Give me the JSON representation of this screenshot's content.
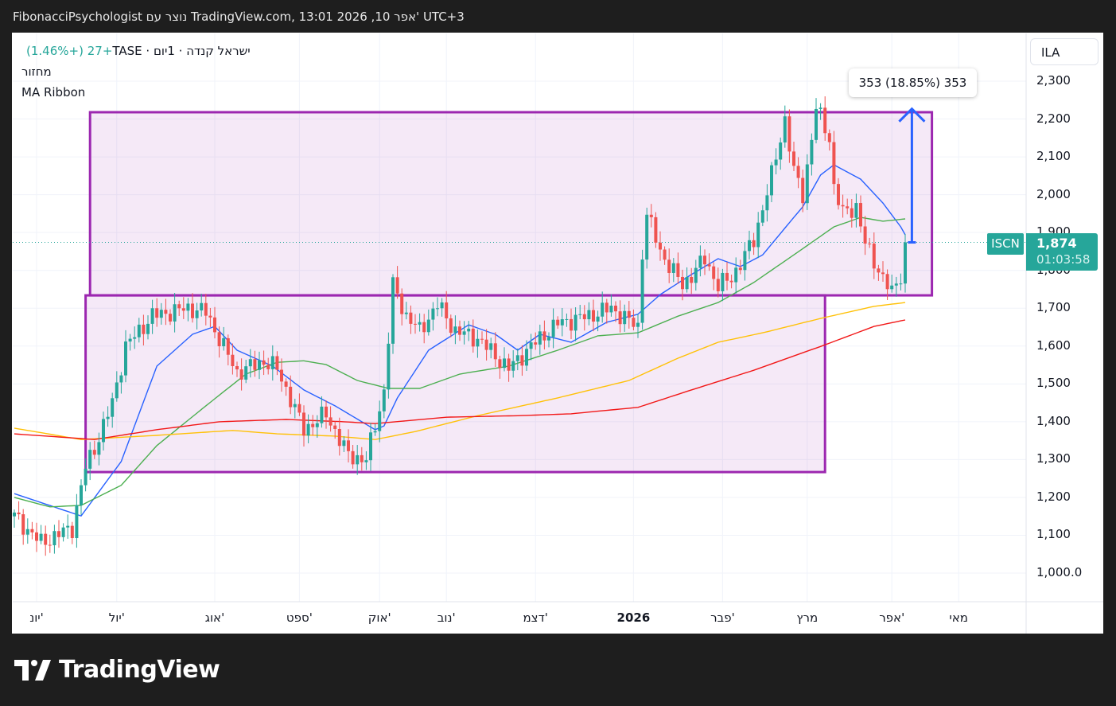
{
  "header": {
    "title": "FibonacciPsychologist נוצר עם TradingView.com, 13:01 2026 ,10 אפר' UTC+3"
  },
  "legend": {
    "symbol_line": "ישראל קנדה · 1יום · TASE",
    "change": "+27 (+1.46%)",
    "volume": "מחזור",
    "indicator": "MA Ribbon"
  },
  "price_axis": {
    "currency": "ILA",
    "ticks": [
      "2,300",
      "2,200",
      "2,100",
      "2,000",
      "1,900",
      "1,800",
      "1,700",
      "1,600",
      "1,500",
      "1,400",
      "1,300",
      "1,200",
      "1,100",
      "1,000.0"
    ]
  },
  "last_price": {
    "symbol": "ISCN",
    "price": "1,874",
    "countdown": "01:03:58"
  },
  "measure": {
    "label": "353 (18.85%) 353"
  },
  "footer": {
    "brand": "TradingView"
  },
  "colors": {
    "up": "#26a69a",
    "down": "#ef5350",
    "ma20": "#2962ff",
    "ma50": "#4caf50",
    "ma100": "#ffc107",
    "ma200": "#f21818",
    "box": "#9c27b0",
    "arrow": "#2962ff"
  },
  "chart_data": {
    "type": "candlestick",
    "yrange": [
      1000,
      2300
    ],
    "xrange_days": [
      0,
      200
    ],
    "time_ticks": [
      {
        "label": "יונ'",
        "day": 5
      },
      {
        "label": "יול'",
        "day": 23
      },
      {
        "label": "אוג'",
        "day": 45
      },
      {
        "label": "ספט'",
        "day": 64
      },
      {
        "label": "אוק'",
        "day": 82
      },
      {
        "label": "נוב'",
        "day": 97
      },
      {
        "label": "דצמ'",
        "day": 117
      },
      {
        "label": "2026",
        "day": 139,
        "bold": true
      },
      {
        "label": "פבר'",
        "day": 159
      },
      {
        "label": "מרץ",
        "day": 178
      },
      {
        "label": "אפר'",
        "day": 197
      },
      {
        "label": "מאי",
        "day": 212
      }
    ],
    "price_ticks": [
      2300,
      2200,
      2100,
      2000,
      1900,
      1800,
      1700,
      1600,
      1500,
      1400,
      1300,
      1200,
      1100,
      1000
    ],
    "close_keypoints": [
      [
        0,
        1150
      ],
      [
        6,
        1080
      ],
      [
        13,
        1120
      ],
      [
        16,
        1280
      ],
      [
        18,
        1330
      ],
      [
        22,
        1450
      ],
      [
        25,
        1600
      ],
      [
        31,
        1680
      ],
      [
        39,
        1700
      ],
      [
        43,
        1690
      ],
      [
        46,
        1620
      ],
      [
        50,
        1530
      ],
      [
        56,
        1560
      ],
      [
        59,
        1540
      ],
      [
        65,
        1380
      ],
      [
        70,
        1420
      ],
      [
        75,
        1310
      ],
      [
        79,
        1300
      ],
      [
        83,
        1480
      ],
      [
        85,
        1760
      ],
      [
        88,
        1680
      ],
      [
        91,
        1640
      ],
      [
        95,
        1710
      ],
      [
        99,
        1640
      ],
      [
        104,
        1620
      ],
      [
        111,
        1540
      ],
      [
        116,
        1600
      ],
      [
        122,
        1660
      ],
      [
        129,
        1680
      ],
      [
        134,
        1700
      ],
      [
        140,
        1650
      ],
      [
        141,
        1850
      ],
      [
        142,
        1950
      ],
      [
        145,
        1850
      ],
      [
        150,
        1760
      ],
      [
        155,
        1830
      ],
      [
        158,
        1760
      ],
      [
        161,
        1780
      ],
      [
        166,
        1880
      ],
      [
        170,
        2050
      ],
      [
        173,
        2200
      ],
      [
        175,
        2060
      ],
      [
        177,
        2000
      ],
      [
        179,
        2150
      ],
      [
        180,
        2230
      ],
      [
        183,
        2150
      ],
      [
        184,
        2020
      ],
      [
        186,
        1950
      ],
      [
        189,
        1970
      ],
      [
        191,
        1870
      ],
      [
        195,
        1780
      ],
      [
        197,
        1740
      ],
      [
        199,
        1790
      ],
      [
        200,
        1874
      ]
    ],
    "ma_series": [
      {
        "name": "MA20",
        "color_key": "ma20",
        "points": [
          [
            0,
            1210
          ],
          [
            15,
            1151
          ],
          [
            24,
            1295
          ],
          [
            32,
            1547
          ],
          [
            40,
            1631
          ],
          [
            45,
            1652
          ],
          [
            50,
            1589
          ],
          [
            58,
            1547
          ],
          [
            65,
            1484
          ],
          [
            72,
            1442
          ],
          [
            81,
            1379
          ],
          [
            83,
            1389
          ],
          [
            86,
            1463
          ],
          [
            93,
            1589
          ],
          [
            102,
            1656
          ],
          [
            108,
            1631
          ],
          [
            113,
            1589
          ],
          [
            118,
            1631
          ],
          [
            125,
            1610
          ],
          [
            133,
            1663
          ],
          [
            140,
            1684
          ],
          [
            145,
            1736
          ],
          [
            152,
            1789
          ],
          [
            158,
            1831
          ],
          [
            163,
            1810
          ],
          [
            168,
            1841
          ],
          [
            174,
            1926
          ],
          [
            177,
            1968
          ],
          [
            181,
            2052
          ],
          [
            184,
            2079
          ],
          [
            190,
            2041
          ],
          [
            195,
            1978
          ],
          [
            199,
            1915
          ],
          [
            200,
            1894
          ]
        ]
      },
      {
        "name": "MA50",
        "color_key": "ma50",
        "points": [
          [
            0,
            1200
          ],
          [
            8,
            1175
          ],
          [
            15,
            1179
          ],
          [
            24,
            1232
          ],
          [
            32,
            1337
          ],
          [
            43,
            1442
          ],
          [
            52,
            1526
          ],
          [
            59,
            1557
          ],
          [
            65,
            1561
          ],
          [
            70,
            1551
          ],
          [
            77,
            1509
          ],
          [
            84,
            1488
          ],
          [
            91,
            1488
          ],
          [
            100,
            1526
          ],
          [
            111,
            1547
          ],
          [
            122,
            1589
          ],
          [
            131,
            1627
          ],
          [
            140,
            1635
          ],
          [
            149,
            1679
          ],
          [
            158,
            1715
          ],
          [
            166,
            1768
          ],
          [
            175,
            1841
          ],
          [
            184,
            1915
          ],
          [
            190,
            1940
          ],
          [
            195,
            1930
          ],
          [
            200,
            1936
          ]
        ]
      },
      {
        "name": "MA100",
        "color_key": "ma100",
        "points": [
          [
            0,
            1383
          ],
          [
            15,
            1353
          ],
          [
            32,
            1364
          ],
          [
            49,
            1377
          ],
          [
            59,
            1368
          ],
          [
            72,
            1362
          ],
          [
            81,
            1353
          ],
          [
            90,
            1374
          ],
          [
            104,
            1416
          ],
          [
            122,
            1463
          ],
          [
            138,
            1509
          ],
          [
            149,
            1568
          ],
          [
            158,
            1610
          ],
          [
            168,
            1635
          ],
          [
            181,
            1673
          ],
          [
            193,
            1705
          ],
          [
            200,
            1715
          ]
        ]
      },
      {
        "name": "MA200",
        "color_key": "ma200",
        "points": [
          [
            0,
            1368
          ],
          [
            18,
            1353
          ],
          [
            32,
            1379
          ],
          [
            46,
            1400
          ],
          [
            61,
            1406
          ],
          [
            74,
            1400
          ],
          [
            81,
            1395
          ],
          [
            97,
            1412
          ],
          [
            113,
            1416
          ],
          [
            125,
            1421
          ],
          [
            140,
            1438
          ],
          [
            152,
            1484
          ],
          [
            166,
            1536
          ],
          [
            181,
            1599
          ],
          [
            193,
            1652
          ],
          [
            200,
            1669
          ]
        ]
      }
    ],
    "annotations": {
      "rectangles": [
        {
          "day_from": 17,
          "day_to": 206,
          "price_top": 2218,
          "price_bottom": 1734
        },
        {
          "day_from": 16,
          "day_to": 182,
          "price_top": 1734,
          "price_bottom": 1267
        }
      ],
      "arrow": {
        "day": 201.5,
        "from_price": 1874,
        "to_price": 2227
      },
      "last_price_line": 1874
    }
  }
}
